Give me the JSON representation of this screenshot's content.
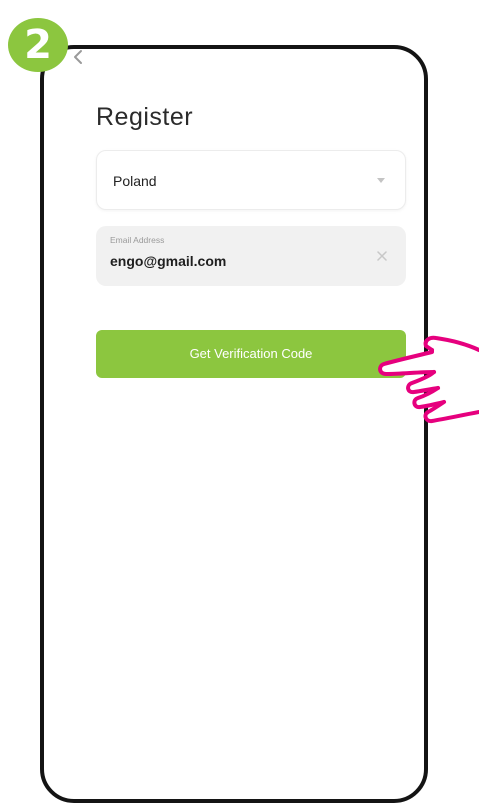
{
  "step": {
    "number": "2"
  },
  "screen": {
    "title": "Register"
  },
  "country": {
    "value": "Poland"
  },
  "email": {
    "label": "Email Address",
    "value": "engo@gmail.com"
  },
  "actions": {
    "get_code_label": "Get Verification Code"
  },
  "icons": {
    "back": "chevron-left-icon",
    "dropdown": "chevron-down-icon",
    "clear": "close-icon",
    "pointer": "pointing-hand-icon"
  },
  "colors": {
    "accent": "#8cc63f",
    "pointer": "#e6007e",
    "outline": "#141414"
  }
}
